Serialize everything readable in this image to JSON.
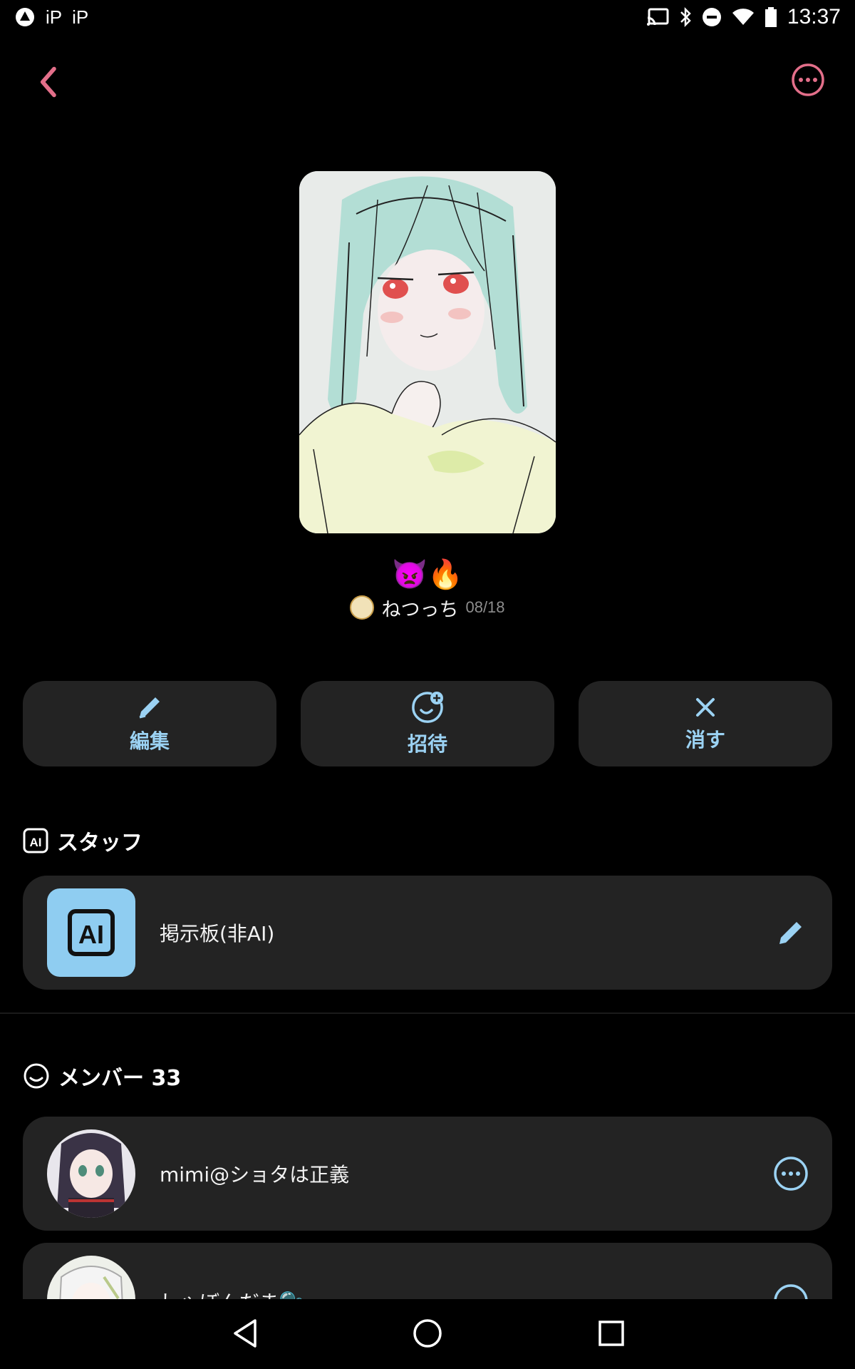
{
  "status_bar": {
    "time": "13:37",
    "left_icons": [
      "app-icon",
      "ip-icon",
      "ip-icon"
    ],
    "left_texts": [
      "iP",
      "iP"
    ],
    "right_icons": [
      "cast-icon",
      "bluetooth-icon",
      "dnd-icon",
      "wifi-icon",
      "battery-icon"
    ]
  },
  "header": {
    "back_icon": "chevron-left-icon",
    "more_icon": "more-circle-icon"
  },
  "post": {
    "emojis": "👿🔥",
    "author": "ねつっち",
    "date": "08/18"
  },
  "actions": [
    {
      "label": "編集",
      "icon": "pencil-icon"
    },
    {
      "label": "招待",
      "icon": "invite-icon"
    },
    {
      "label": "消す",
      "icon": "close-icon"
    }
  ],
  "staff_section": {
    "title": "スタッフ",
    "icon": "ai-icon",
    "item": {
      "label": "掲示板(非AI)",
      "action_icon": "pencil-icon"
    }
  },
  "members_section": {
    "title": "メンバー 33",
    "icon": "smile-icon",
    "items": [
      {
        "label": "mimi@ショタは正義",
        "action_icon": "more-circle-icon"
      },
      {
        "label": "しゃぼんだま🫧",
        "action_icon": "more-circle-icon"
      }
    ]
  },
  "colors": {
    "accent_pink": "#e36f8a",
    "accent_blue": "#9bd2f3",
    "card_bg": "#232323"
  }
}
